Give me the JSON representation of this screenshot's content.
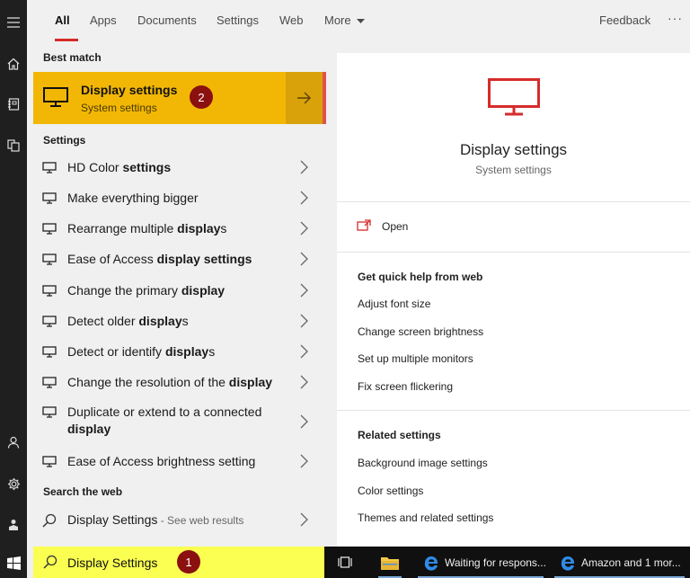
{
  "tabs": {
    "all": "All",
    "apps": "Apps",
    "documents": "Documents",
    "settings": "Settings",
    "web": "Web",
    "more": "More",
    "feedback": "Feedback",
    "overflow": "···"
  },
  "best_match": {
    "header": "Best match",
    "title": "Display settings",
    "subtitle": "System settings",
    "badge": "2"
  },
  "settings_section": {
    "header": "Settings",
    "items": [
      {
        "pre": "HD Color ",
        "bold": "settings",
        "post": ""
      },
      {
        "pre": "Make everything bigger",
        "bold": "",
        "post": ""
      },
      {
        "pre": "Rearrange multiple ",
        "bold": "display",
        "post": "s"
      },
      {
        "pre": "Ease of Access ",
        "bold": "display settings",
        "post": ""
      },
      {
        "pre": "Change the primary ",
        "bold": "display",
        "post": ""
      },
      {
        "pre": "Detect older ",
        "bold": "display",
        "post": "s"
      },
      {
        "pre": "Detect or identify ",
        "bold": "display",
        "post": "s"
      },
      {
        "pre": "Change the resolution of the ",
        "bold": "display",
        "post": ""
      },
      {
        "pre": "Duplicate or extend to a connected ",
        "bold": "display",
        "post": ""
      },
      {
        "pre": "Ease of Access brightness setting",
        "bold": "",
        "post": ""
      }
    ]
  },
  "web_section": {
    "header": "Search the web",
    "query": "Display Settings",
    "hint": " - See web results"
  },
  "preview": {
    "title": "Display settings",
    "subtitle": "System settings",
    "open": "Open",
    "quick_help_header": "Get quick help from web",
    "quick_help": [
      "Adjust font size",
      "Change screen brightness",
      "Set up multiple monitors",
      "Fix screen flickering"
    ],
    "related_header": "Related settings",
    "related": [
      "Background image settings",
      "Color settings",
      "Themes and related settings"
    ],
    "accent_color": "#d62b2b"
  },
  "search": {
    "value": "Display Settings",
    "badge": "1"
  },
  "taskbar": {
    "items": [
      "Waiting for respons...",
      "Amazon and 1 mor..."
    ]
  },
  "colors": {
    "best_match_bg": "#f2b705",
    "search_bg": "#fbff52",
    "badge_bg": "#8b1010",
    "rail_bg": "#1f1f1f",
    "taskbar_bg": "#101010"
  }
}
